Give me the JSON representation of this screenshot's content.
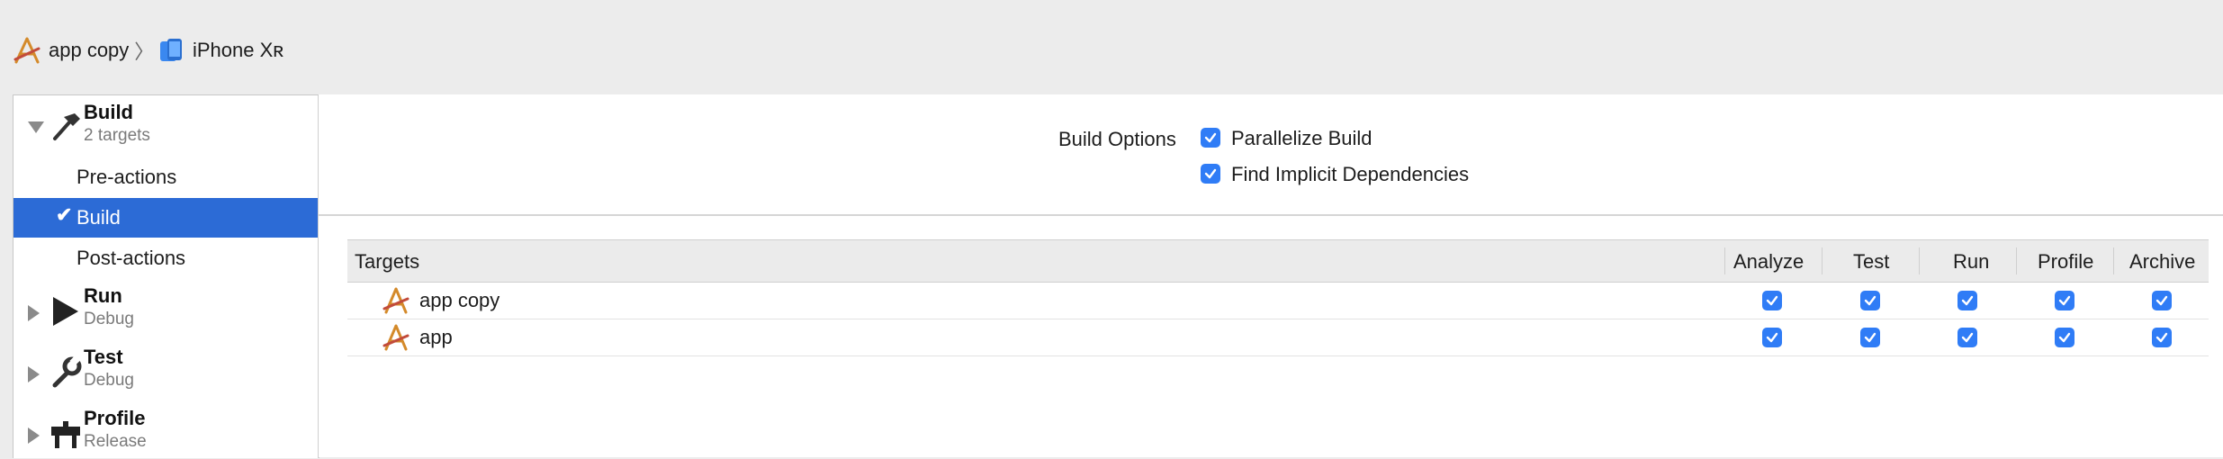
{
  "breadcrumb": {
    "project": "app copy",
    "separator": "〉",
    "device": "iPhone Xʀ"
  },
  "sidebar": {
    "build": {
      "title": "Build",
      "subtitle": "2 targets"
    },
    "build_actions": [
      {
        "label": "Pre-actions",
        "selected": false
      },
      {
        "label": "Build",
        "selected": true
      },
      {
        "label": "Post-actions",
        "selected": false
      }
    ],
    "run": {
      "title": "Run",
      "subtitle": "Debug"
    },
    "test": {
      "title": "Test",
      "subtitle": "Debug"
    },
    "profile": {
      "title": "Profile",
      "subtitle": "Release"
    }
  },
  "build_options": {
    "label": "Build Options",
    "parallelize": {
      "label": "Parallelize Build",
      "checked": true
    },
    "implicit": {
      "label": "Find Implicit Dependencies",
      "checked": true
    }
  },
  "targets_table": {
    "columns": [
      "Targets",
      "Analyze",
      "Test",
      "Run",
      "Profile",
      "Archive"
    ],
    "rows": [
      {
        "name": "app copy",
        "analyze": true,
        "test": true,
        "run": true,
        "profile": true,
        "archive": true
      },
      {
        "name": "app",
        "analyze": true,
        "test": true,
        "run": true,
        "profile": true,
        "archive": true
      }
    ]
  },
  "colors": {
    "accent": "#2c6bd6",
    "checkbox": "#2f7cf6"
  },
  "icons": {
    "project": "xcode-app-icon",
    "device": "iphone-icon",
    "build": "hammer-icon",
    "run": "play-icon",
    "test": "wrench-icon",
    "profile": "gauge-icon"
  }
}
